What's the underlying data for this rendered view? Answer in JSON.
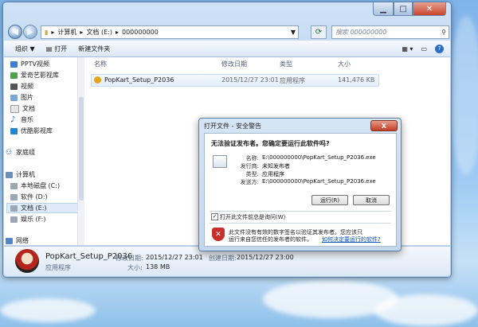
{
  "explorer": {
    "breadcrumb": [
      "计算机",
      "文档 (E:)",
      "000000000"
    ],
    "search_placeholder": "搜索 000000000",
    "toolbar": {
      "organize": "组织 ▼",
      "open": "打开",
      "new_folder": "新建文件夹"
    },
    "sidebar": {
      "items": [
        "PPTV视频",
        "爱奇艺影视库",
        "视频",
        "图片",
        "文档",
        "音乐",
        "优酷影视库"
      ],
      "homegroup": "家庭组",
      "computer": "计算机",
      "drives": [
        "本地磁盘 (C:)",
        "软件 (D:)",
        "文档 (E:)",
        "娱乐 (F:)"
      ],
      "network": "网络"
    },
    "columns": {
      "name": "名称",
      "date": "修改日期",
      "type": "类型",
      "size": "大小"
    },
    "file": {
      "name": "PopKart_Setup_P2036",
      "date": "2015/12/27 23:01",
      "type": "应用程序",
      "size": "141,476 KB"
    },
    "details": {
      "name": "PopKart_Setup_P2036",
      "modified_label": "修改日期:",
      "modified": "2015/12/27 23:01",
      "created_label": "创建日期:",
      "created": "2015/12/27 23:00",
      "type": "应用程序",
      "size_label": "大小:",
      "size": "138 MB"
    }
  },
  "dialog": {
    "title": "打开文件 - 安全警告",
    "close": "X",
    "question": "无法验证发布者。您确定要运行此软件吗?",
    "name_label": "名称:",
    "name": "E:\\000000000\\PopKart_Setup_P2036.exe",
    "publisher_label": "发行商:",
    "publisher": "未知发布者",
    "type_label": "类型:",
    "type": "应用程序",
    "from_label": "发送方:",
    "from": "E:\\000000000\\PopKart_Setup_P2036.exe",
    "run": "运行(R)",
    "cancel": "取消",
    "always_ask": "打开此文件前总是询问(W)",
    "always_ask_checked": true,
    "warning_line1": "此文件没有有效的数字签名以验证其发布者。您应该只",
    "warning_line2": "运行来自您信任的发布者的软件。",
    "warning_link": "如何决定要运行的软件?"
  }
}
